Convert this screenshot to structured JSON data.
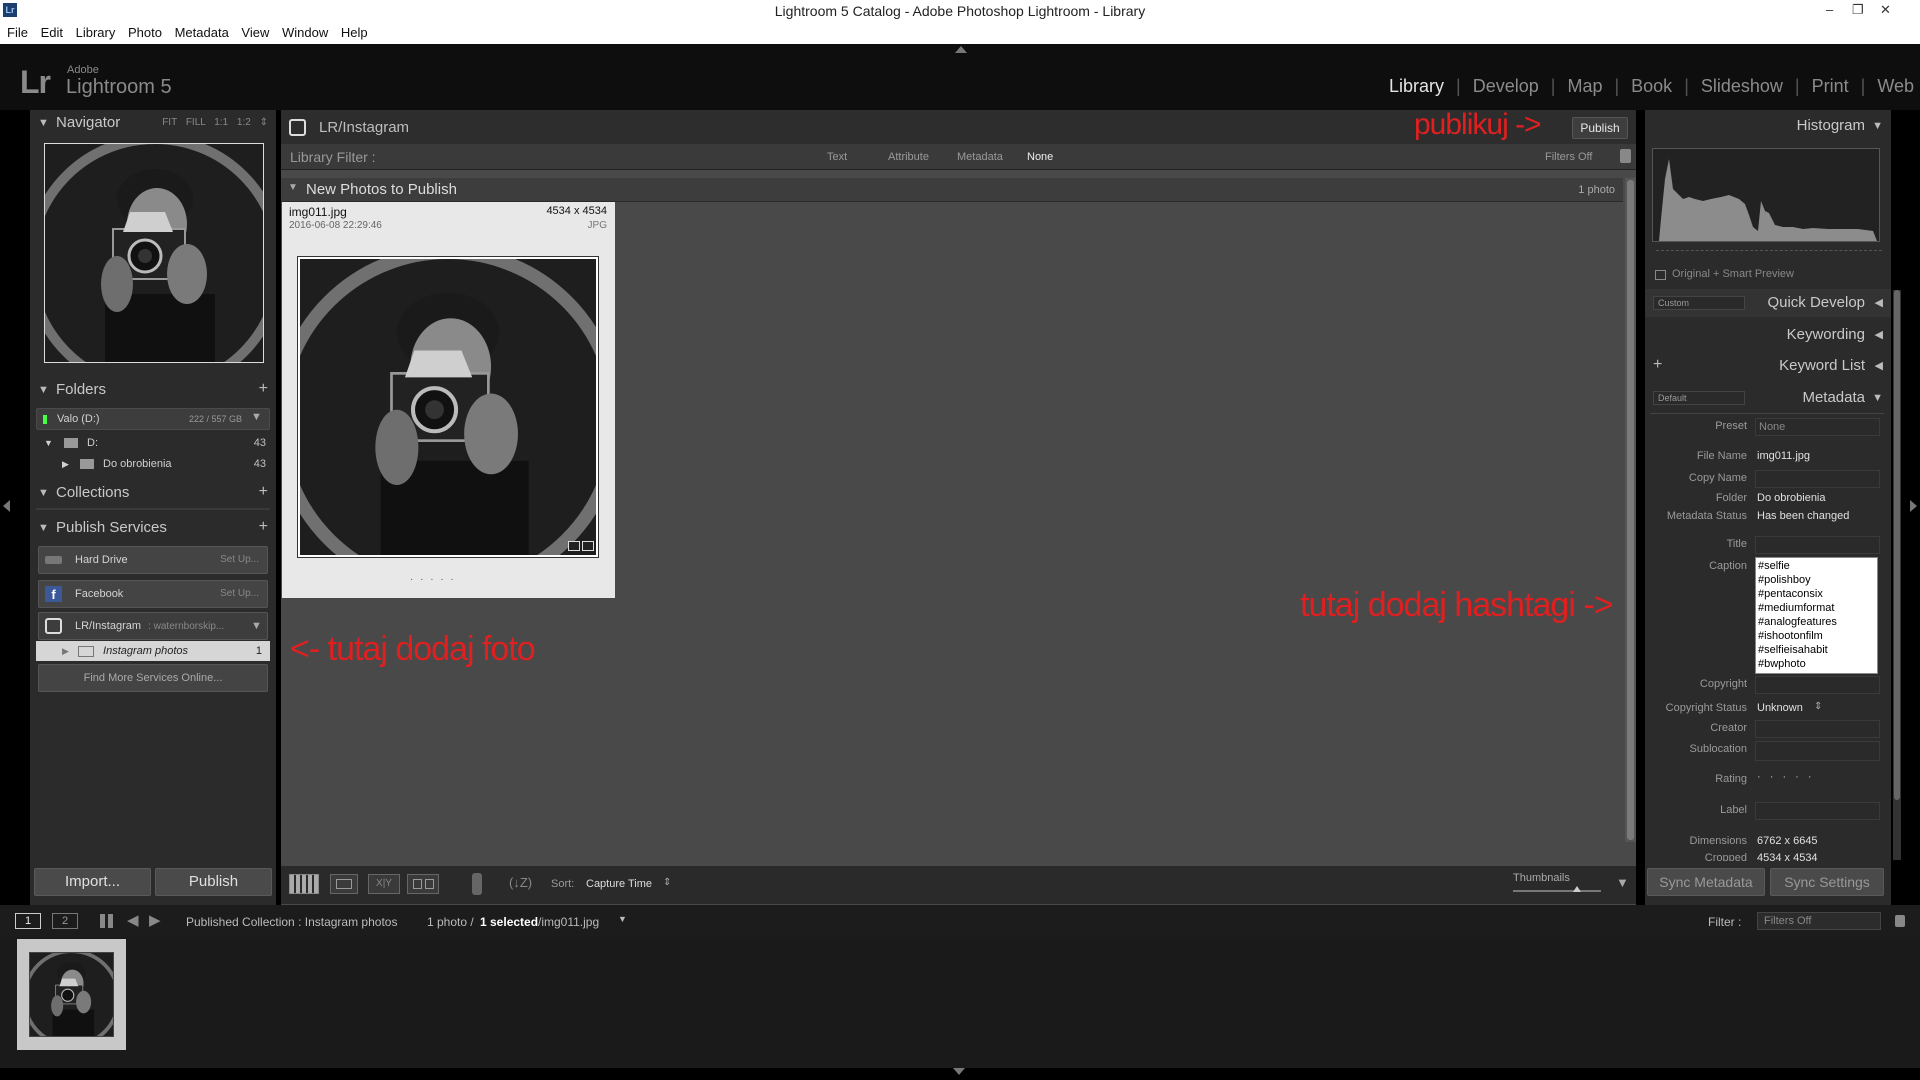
{
  "window": {
    "title": "Lightroom 5 Catalog - Adobe Photoshop Lightroom - Library",
    "app_icon": "Lr",
    "minimize": "–",
    "restore": "❐",
    "close": "✕"
  },
  "menu": [
    "File",
    "Edit",
    "Library",
    "Photo",
    "Metadata",
    "View",
    "Window",
    "Help"
  ],
  "identity": {
    "lr": "Lr",
    "adobe": "Adobe",
    "product": "Lightroom 5"
  },
  "modules": [
    {
      "label": "Library",
      "active": true
    },
    {
      "label": "Develop"
    },
    {
      "label": "Map"
    },
    {
      "label": "Book"
    },
    {
      "label": "Slideshow"
    },
    {
      "label": "Print"
    },
    {
      "label": "Web"
    }
  ],
  "navigator": {
    "title": "Navigator",
    "zoom_options": [
      "FIT",
      "FILL",
      "1:1",
      "1:2"
    ]
  },
  "folders": {
    "title": "Folders",
    "volume": {
      "name": "Valo (D:)",
      "space": "222 / 557 GB"
    },
    "items": [
      {
        "name": "D:",
        "count": "43"
      },
      {
        "name": "Do obrobienia",
        "count": "43"
      }
    ]
  },
  "collections": {
    "title": "Collections"
  },
  "publish_services": {
    "title": "Publish Services",
    "services": [
      {
        "name": "Hard Drive",
        "action": "Set Up..."
      },
      {
        "name": "Facebook",
        "action": "Set Up..."
      },
      {
        "name": "LR/Instagram",
        "account": ": waternborskip..."
      }
    ],
    "collection": {
      "name": "Instagram photos",
      "count": "1"
    },
    "find_more": "Find More Services Online..."
  },
  "left_buttons": {
    "import": "Import...",
    "publish": "Publish"
  },
  "publish_header": {
    "service": "LR/Instagram",
    "button": "Publish"
  },
  "library_filter": {
    "label": "Library Filter :",
    "options": [
      "Text",
      "Attribute",
      "Metadata",
      "None"
    ],
    "active": "None",
    "status": "Filters Off"
  },
  "collection_header": {
    "title": "New Photos to Publish",
    "count": "1 photo"
  },
  "thumbnail": {
    "filename": "img011.jpg",
    "dimensions": "4534 x 4534",
    "date": "2016-06-08 22:29:46",
    "format": "JPG",
    "rating_dots": "· · · · ·"
  },
  "annotations": {
    "publish": "publikuj ->",
    "add_photo": "<- tutaj dodaj foto",
    "hashtags": "tutaj dodaj hashtagi ->"
  },
  "toolbar": {
    "sort_label": "Sort:",
    "sort_value": "Capture Time",
    "thumbnails_label": "Thumbnails"
  },
  "histogram": {
    "title": "Histogram",
    "preview_label": "Original + Smart Preview"
  },
  "quick_develop": {
    "title": "Quick Develop",
    "preset": "Custom"
  },
  "keywording": {
    "title": "Keywording"
  },
  "keyword_list": {
    "title": "Keyword List"
  },
  "metadata": {
    "title": "Metadata",
    "preset_select": "Default",
    "fields": [
      {
        "label": "Preset",
        "value": "None"
      },
      {
        "label": "File Name",
        "value": "img011.jpg"
      },
      {
        "label": "Copy Name",
        "value": ""
      },
      {
        "label": "Folder",
        "value": "Do obrobienia"
      },
      {
        "label": "Metadata Status",
        "value": "Has been changed"
      },
      {
        "label": "Title",
        "value": ""
      },
      {
        "label": "Caption",
        "value": "#selfie #polishboy #pentaconsix #mediumformat #analogfeatures #ishootonfilm #selfieisahabit #bwphoto #bwphotography #"
      },
      {
        "label": "Copyright",
        "value": ""
      },
      {
        "label": "Copyright Status",
        "value": "Unknown"
      },
      {
        "label": "Creator",
        "value": ""
      },
      {
        "label": "Sublocation",
        "value": ""
      },
      {
        "label": "Rating",
        "value": "· · · · ·"
      },
      {
        "label": "Label",
        "value": ""
      },
      {
        "label": "Dimensions",
        "value": "6762 x 6645"
      },
      {
        "label": "Cropped",
        "value": "4534 x 4534"
      }
    ]
  },
  "right_buttons": {
    "sync_metadata": "Sync Metadata",
    "sync_settings": "Sync Settings"
  },
  "filmstrip_bar": {
    "screen1": "1",
    "screen2": "2",
    "source": "Published Collection : Instagram photos",
    "count_text": "1 photo /",
    "selected": "1 selected",
    "file": "/img011.jpg",
    "filter_label": "Filter :",
    "filter_value": "Filters Off"
  }
}
